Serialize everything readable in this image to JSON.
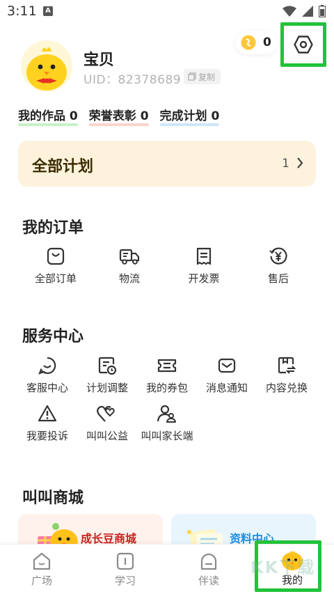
{
  "status_bar": {
    "time": "3:11",
    "notification_icon": "a-icon"
  },
  "profile": {
    "name": "宝贝",
    "uid": "UID：82378689",
    "copy_label": "复制",
    "coins": "0"
  },
  "stats": [
    {
      "label": "我的作品",
      "value": "0",
      "underline_color": "#c9f0c9"
    },
    {
      "label": "荣誉表彰",
      "value": "0",
      "underline_color": "#fad4cc"
    },
    {
      "label": "完成计划",
      "value": "0",
      "underline_color": "#cde6fb"
    }
  ],
  "plans": {
    "title": "全部计划",
    "count": "1"
  },
  "orders": {
    "title": "我的订单",
    "items": [
      {
        "label": "全部订单",
        "icon": "shopping-bag-icon"
      },
      {
        "label": "物流",
        "icon": "truck-icon"
      },
      {
        "label": "开发票",
        "icon": "receipt-icon"
      },
      {
        "label": "售后",
        "icon": "yuan-refund-icon"
      }
    ]
  },
  "services": {
    "title": "服务中心",
    "items": [
      {
        "label": "客服中心",
        "icon": "chat-bubble-icon"
      },
      {
        "label": "计划调整",
        "icon": "schedule-icon"
      },
      {
        "label": "我的券包",
        "icon": "ticket-icon"
      },
      {
        "label": "消息通知",
        "icon": "envelope-icon"
      },
      {
        "label": "内容兑换",
        "icon": "exchange-icon"
      },
      {
        "label": "我要投诉",
        "icon": "warning-icon"
      },
      {
        "label": "叫叫公益",
        "icon": "hearts-icon"
      },
      {
        "label": "叫叫家长端",
        "icon": "parents-icon"
      }
    ]
  },
  "mall": {
    "title": "叫叫商城",
    "cards": [
      {
        "label": "成长豆商城",
        "color": "#c8231f"
      },
      {
        "label": "资料中心",
        "color": "#1f8ee0"
      }
    ]
  },
  "tabs": [
    {
      "label": "广场",
      "icon": "house-icon"
    },
    {
      "label": "学习",
      "icon": "book-icon"
    },
    {
      "label": "伴读",
      "icon": "companion-icon"
    },
    {
      "label": "我的",
      "icon": "chick-icon"
    }
  ],
  "watermark": "KK下载",
  "colors": {
    "highlight": "#22c33a",
    "plans_bg": "#fdf3dd",
    "coin": "#ffc83a"
  }
}
